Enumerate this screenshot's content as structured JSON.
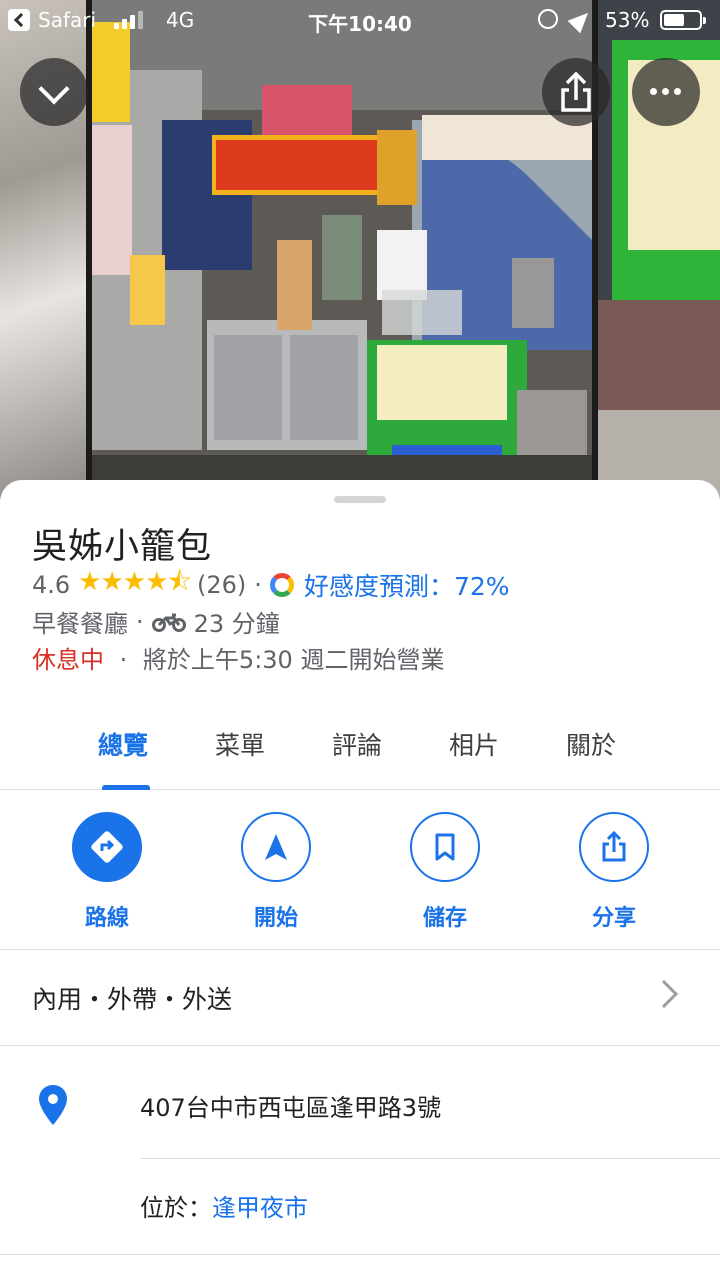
{
  "status_bar": {
    "carrier": "Safari",
    "network": "4G",
    "time": "下午10:40",
    "battery": "53%"
  },
  "place": {
    "name": "吳姊小籠包",
    "rating": "4.6",
    "stars": "★★★★⯪",
    "review_count": "(26)",
    "match_label": "好感度預測：72%",
    "category": "早餐餐廳",
    "travel_time": "23 分鐘",
    "status": "休息中",
    "opens": "將於上午5:30 週二開始營業"
  },
  "tabs": [
    {
      "label": "總覽",
      "active": true
    },
    {
      "label": "菜單"
    },
    {
      "label": "評論"
    },
    {
      "label": "相片"
    },
    {
      "label": "關於"
    }
  ],
  "actions": [
    {
      "label": "路線",
      "icon": "directions-icon"
    },
    {
      "label": "開始",
      "icon": "navigation-icon"
    },
    {
      "label": "儲存",
      "icon": "bookmark-icon"
    },
    {
      "label": "分享",
      "icon": "share-icon"
    }
  ],
  "services": "內用・外帶・外送",
  "address": "407台中市西屯區逢甲路3號",
  "located_in": {
    "prefix": "位於：",
    "place": "逢甲夜市"
  },
  "colors": {
    "accent": "#1a73e8",
    "star": "#fbbc04",
    "closed": "#d93025"
  }
}
